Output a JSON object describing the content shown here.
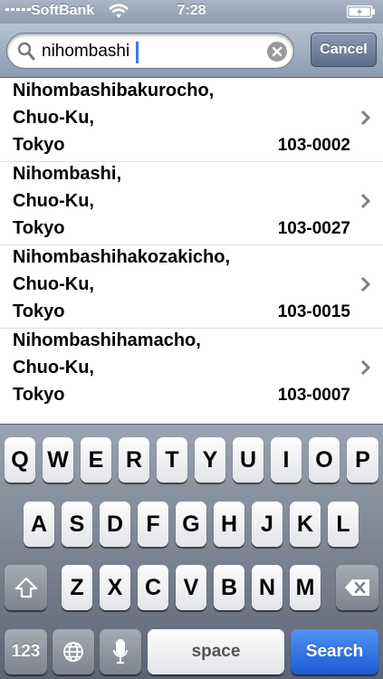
{
  "status_bar": {
    "carrier": "SoftBank",
    "time": "7:28"
  },
  "search": {
    "query": "nihombashi",
    "cancel_label": "Cancel"
  },
  "results": [
    {
      "line1": "Nihombashibakurocho,",
      "line2": "Chuo-Ku,",
      "line3": "Tokyo",
      "postal_code": "103-0002"
    },
    {
      "line1": "Nihombashi,",
      "line2": "Chuo-Ku,",
      "line3": "Tokyo",
      "postal_code": "103-0027"
    },
    {
      "line1": "Nihombashihakozakicho,",
      "line2": "Chuo-Ku,",
      "line3": "Tokyo",
      "postal_code": "103-0015"
    },
    {
      "line1": "Nihombashihamacho,",
      "line2": "Chuo-Ku,",
      "line3": "Tokyo",
      "postal_code": "103-0007"
    }
  ],
  "keyboard": {
    "row1": [
      "Q",
      "W",
      "E",
      "R",
      "T",
      "Y",
      "U",
      "I",
      "O",
      "P"
    ],
    "row2": [
      "A",
      "S",
      "D",
      "F",
      "G",
      "H",
      "J",
      "K",
      "L"
    ],
    "row3": [
      "Z",
      "X",
      "C",
      "V",
      "B",
      "N",
      "M"
    ],
    "numbers_label": "123",
    "space_label": "space",
    "search_label": "Search",
    "icons": {
      "shift": "shift-icon",
      "delete": "delete-icon",
      "globe": "globe-icon",
      "mic": "microphone-icon"
    }
  }
}
